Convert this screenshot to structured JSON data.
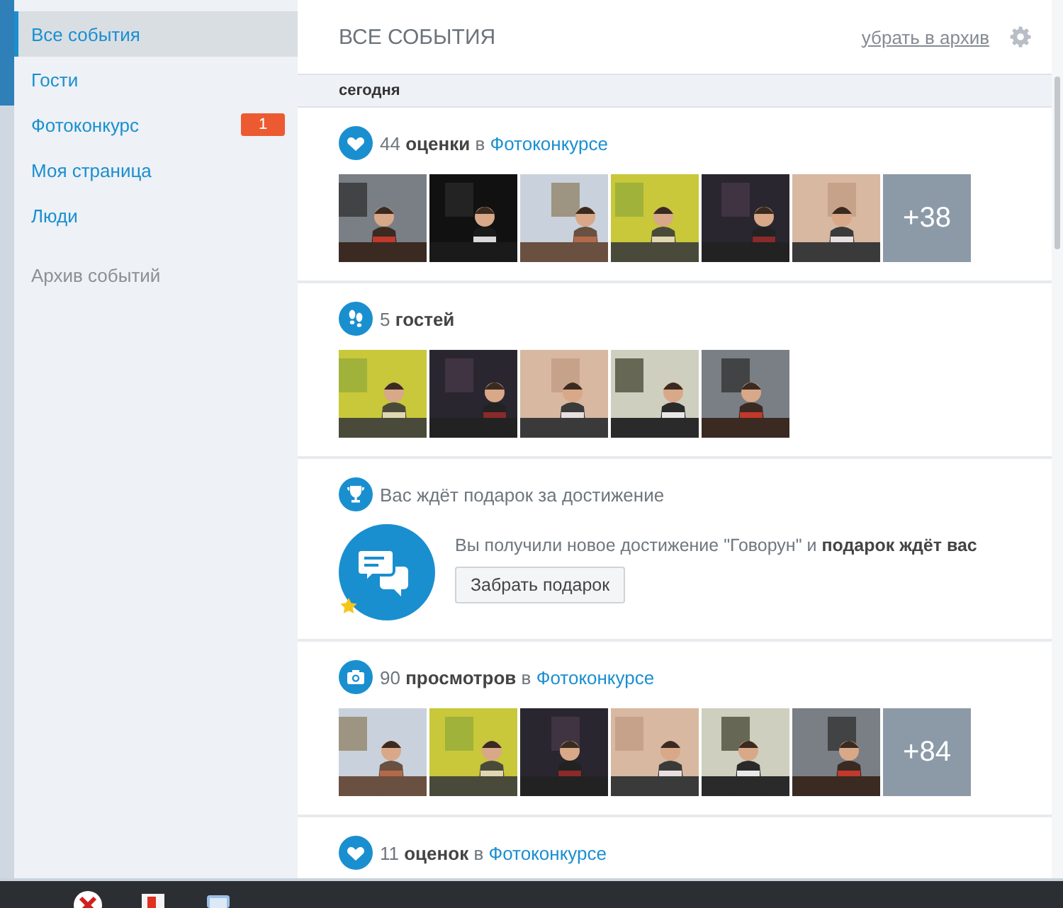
{
  "sidebar": {
    "items": [
      {
        "label": "Все события",
        "selected": true
      },
      {
        "label": "Гости",
        "selected": false
      },
      {
        "label": "Фотоконкурс",
        "selected": false,
        "badge": "1"
      },
      {
        "label": "Моя страница",
        "selected": false
      },
      {
        "label": "Люди",
        "selected": false
      }
    ],
    "archive_link": "Архив событий"
  },
  "header": {
    "title": "ВСЕ СОБЫТИЯ",
    "archive_action": "убрать в архив"
  },
  "date_label": "сегодня",
  "events": [
    {
      "kind": "ratings",
      "count": "44",
      "action": "оценки",
      "preposition": "в",
      "link": "Фотоконкурсе",
      "more": "+38"
    },
    {
      "kind": "guests",
      "count": "5",
      "action": "гостей"
    },
    {
      "kind": "achievement",
      "title": "Вас ждёт подарок за достижение",
      "message": "Вы получили новое достижение \"Говорун\" и **подарок ждёт вас**",
      "button": "Забрать подарок"
    },
    {
      "kind": "views",
      "count": "90",
      "action": "просмотров",
      "preposition": "в",
      "link": "Фотоконкурсе",
      "more": "+84"
    },
    {
      "kind": "ratings",
      "count": "11",
      "action": "оценок",
      "preposition": "в",
      "link": "Фотоконкурсе"
    }
  ]
}
